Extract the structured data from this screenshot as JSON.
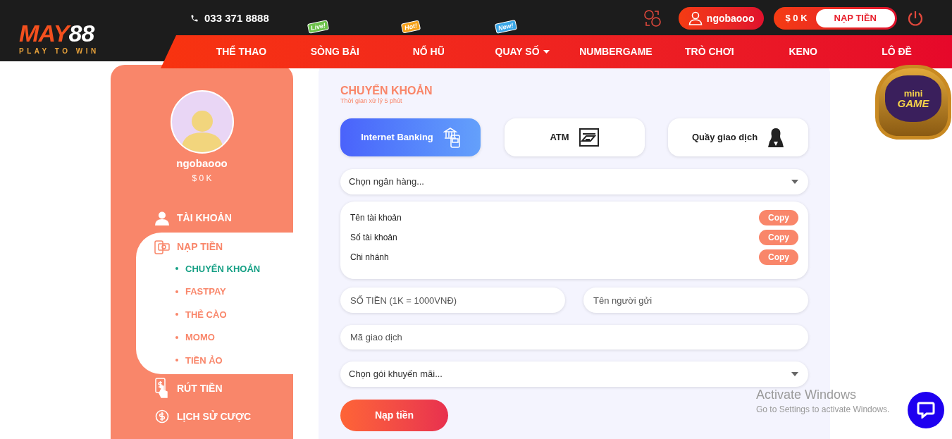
{
  "header": {
    "logo": {
      "brand": "MAY",
      "brand_number": "88",
      "tagline": "PLAY TO WIN"
    },
    "phone": "033 371 8888",
    "username": "ngobaooo",
    "balance": "$ 0 K",
    "deposit_button": "NẠP TIỀN"
  },
  "nav": [
    {
      "label": "THỂ THAO"
    },
    {
      "label": "SÒNG BÀI",
      "badge": "Live!",
      "color": "#6cc24a"
    },
    {
      "label": "NỔ HŨ",
      "badge": "Hot!",
      "color": "#f7a21b"
    },
    {
      "label": "QUAY SỐ",
      "badge": "New!",
      "color": "#3aa7e8",
      "dropdown": true
    },
    {
      "label": "NUMBERGAME"
    },
    {
      "label": "TRÒ CHƠI"
    },
    {
      "label": "KENO"
    },
    {
      "label": "LÔ ĐỀ"
    }
  ],
  "sidebar": {
    "username": "ngobaooo",
    "balance": "$ 0 K",
    "items": [
      {
        "label": "TÀI KHOẢN",
        "kind": "user",
        "selected": false
      },
      {
        "label": "NẠP TIỀN",
        "kind": "deposit",
        "selected": true,
        "children": [
          {
            "label": "CHUYỂN KHOẢN",
            "selected": true
          },
          {
            "label": "FASTPAY",
            "selected": false
          },
          {
            "label": "THẺ CÀO",
            "selected": false
          },
          {
            "label": "MOMO",
            "selected": false
          },
          {
            "label": "TIỀN ẢO",
            "selected": false
          }
        ]
      },
      {
        "label": "RÚT TIỀN",
        "kind": "withdraw",
        "selected": false
      },
      {
        "label": "LỊCH SỬ CƯỢC",
        "kind": "history",
        "selected": false
      }
    ]
  },
  "transfer": {
    "title": "CHUYỂN KHOẢN",
    "subtitle": "Thời gian xử lý 5 phút",
    "methods": [
      {
        "label": "Internet Banking",
        "kind": "bank",
        "selected": true
      },
      {
        "label": "ATM",
        "kind": "atm",
        "selected": false
      },
      {
        "label": "Quầy giao dịch",
        "kind": "teller",
        "selected": false
      }
    ],
    "bank_select": {
      "placeholder": "Chọn ngân hàng..."
    },
    "account_info": [
      {
        "label": "Tên tài khoản",
        "button": "Copy"
      },
      {
        "label": "Số tài khoản",
        "button": "Copy"
      },
      {
        "label": "Chi nhánh",
        "button": "Copy"
      }
    ],
    "amount_field": {
      "placeholder": "SỐ TIỀN (1K = 1000VNĐ)"
    },
    "sender_field": {
      "placeholder": "Tên người gửi"
    },
    "transaction_field": {
      "placeholder": "Mã giao dịch"
    },
    "promo_select": {
      "placeholder": "Chọn gói khuyến mãi..."
    },
    "submit_button": "Nạp tiền"
  },
  "mini_game": {
    "line1": "mini",
    "line2": "GAME"
  },
  "windows_notice": {
    "title": "Activate Windows",
    "message": "Go to Settings to activate Windows."
  }
}
